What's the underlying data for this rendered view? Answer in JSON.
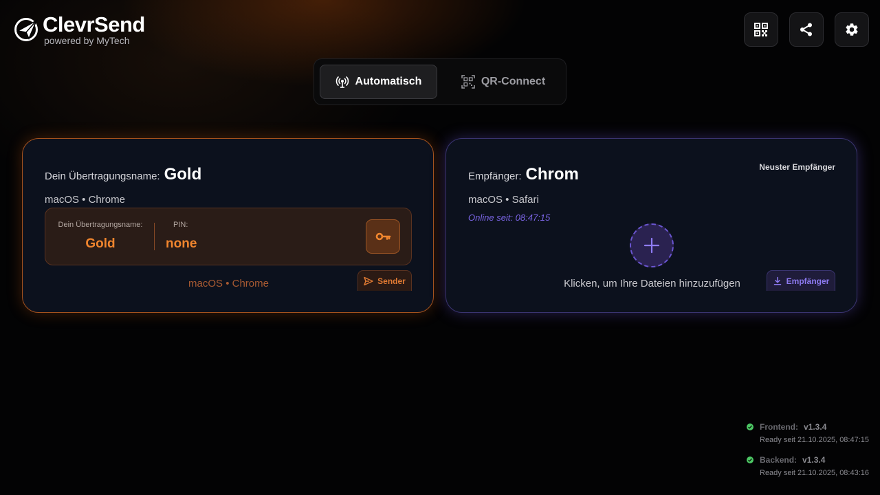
{
  "brand": {
    "title": "ClevrSend",
    "subtitle": "powered by MyTech"
  },
  "toolbar": {
    "buttons": [
      {
        "icon": "qr-code-icon"
      },
      {
        "icon": "share-icon"
      },
      {
        "icon": "gear-icon"
      }
    ]
  },
  "mode": {
    "tabs": [
      {
        "label": "Automatisch",
        "icon": "broadcast-icon",
        "active": true
      },
      {
        "label": "QR-Connect",
        "icon": "qr-scan-icon",
        "active": false
      }
    ]
  },
  "sender_card": {
    "name_label": "Dein Übertragungsname:",
    "name_value": "Gold",
    "device": "macOS • Chrome",
    "info_name_label": "Dein Übertragungsname:",
    "info_name_value": "Gold",
    "pin_label": "PIN:",
    "pin_value": "none",
    "footer_device": "macOS • Chrome",
    "role_label": "Sender",
    "accent": "#f0852e"
  },
  "receiver_card": {
    "name_label": "Empfänger:",
    "name_value": "Chrom",
    "badge": "Neuster Empfänger",
    "device": "macOS • Safari",
    "online": "Online seit: 08:47:15",
    "add_hint": "Klicken, um Ihre Dateien hinzuzufügen",
    "role_label": "Empfänger",
    "accent": "#7c66e8"
  },
  "status": [
    {
      "name": "Frontend:",
      "version": "v1.3.4",
      "ready": "Ready seit 21.10.2025, 08:47:15"
    },
    {
      "name": "Backend:",
      "version": "v1.3.4",
      "ready": "Ready seit 21.10.2025, 08:43:16"
    }
  ]
}
